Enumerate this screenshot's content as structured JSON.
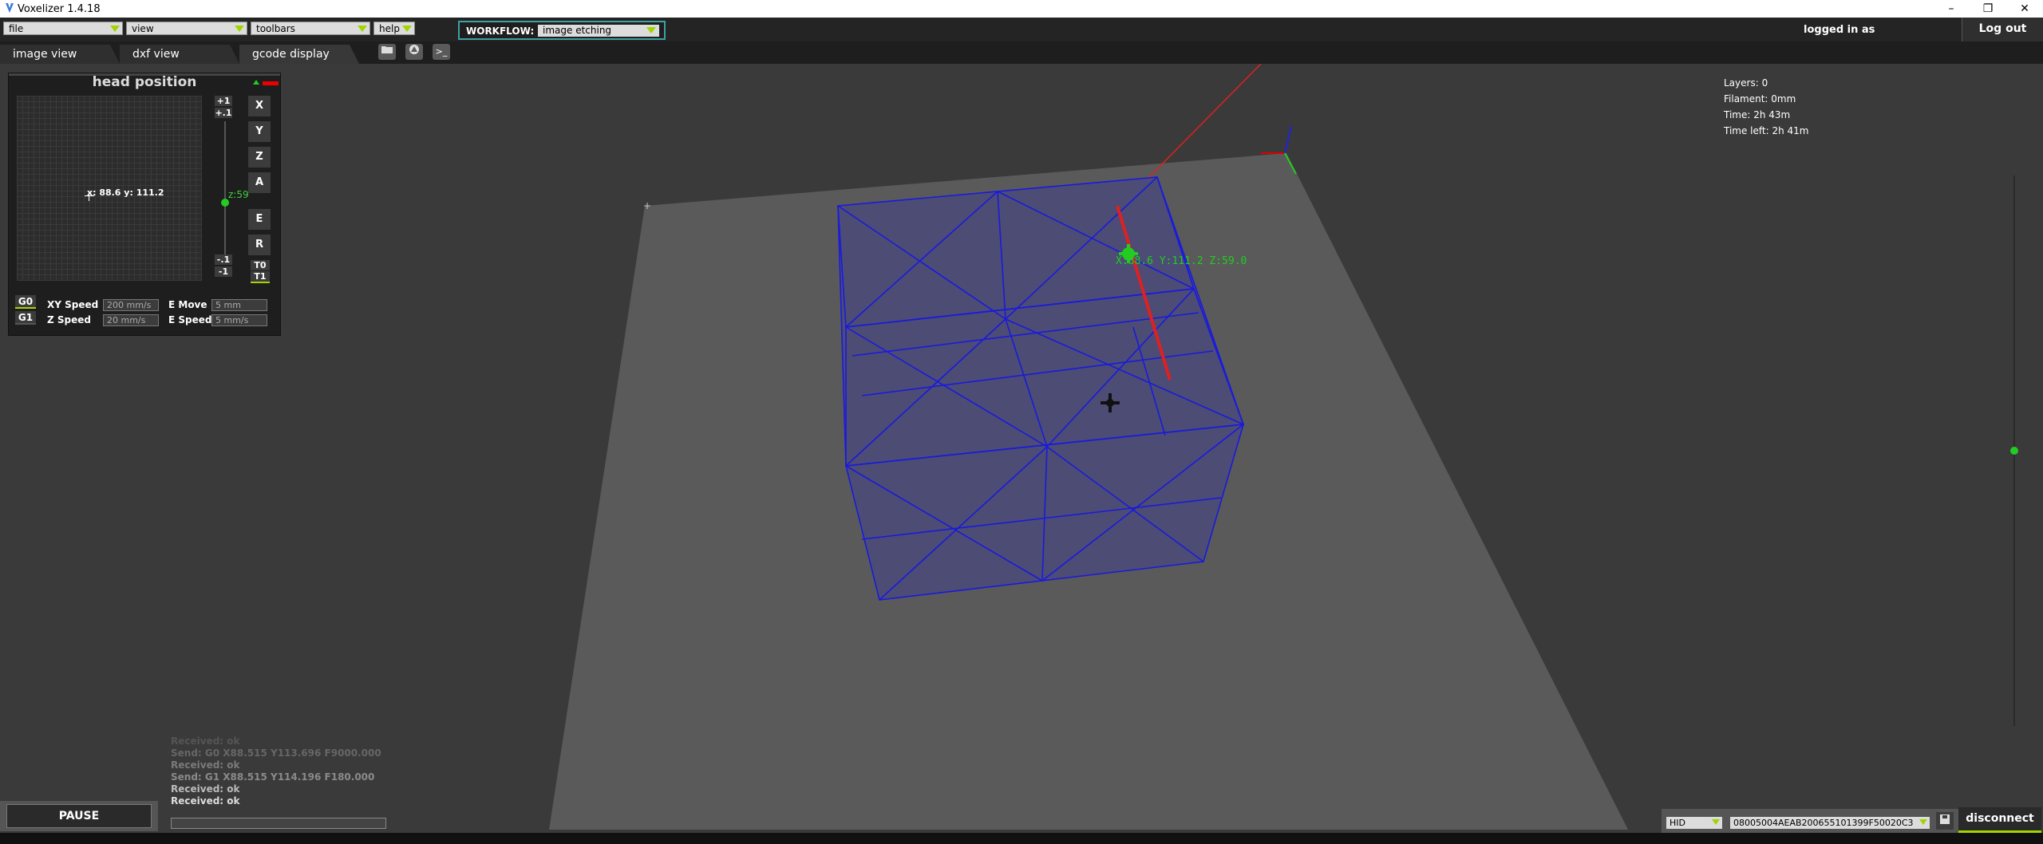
{
  "window": {
    "title": "Voxelizer 1.4.18",
    "controls": [
      "–",
      "❐",
      "✕"
    ]
  },
  "menubar": {
    "file": "file",
    "view": "view",
    "toolbars": "toolbars",
    "help": "help",
    "workflow_label": "WORKFLOW:",
    "workflow_value": "image etching",
    "logged_in": "logged in as",
    "logout": "Log out"
  },
  "tabs": {
    "image_view": "image view",
    "dxf_view": "dxf view",
    "gcode_display": "gcode display",
    "gcode_btn": "Gcode",
    "terminal_btn": ">_"
  },
  "head_panel": {
    "title": "head position",
    "readout": "x: 88.6 y: 111.2",
    "z_label": "z:59",
    "step_up_1": "+1",
    "step_up_01": "+.1",
    "step_down_01": "-.1",
    "step_down_1": "-1",
    "axes": [
      "X",
      "Y",
      "Z",
      "A",
      "E",
      "R"
    ],
    "t0": "T0",
    "t1": "T1",
    "g0": "G0",
    "g1": "G1",
    "xy_speed_label": "XY Speed",
    "xy_speed_value": "200 mm/s",
    "z_speed_label": "Z Speed",
    "z_speed_value": "20 mm/s",
    "e_move_label": "E Move",
    "e_move_value": "5 mm",
    "e_speed_label": "E Speed",
    "e_speed_value": "5 mm/s"
  },
  "stats": {
    "layers": "Layers: 0",
    "filament": "Filament: 0mm",
    "time": "Time: 2h 43m",
    "time_left": "Time left: 2h 41m"
  },
  "head_label": "X:88.6 Y:111.2 Z:59.0",
  "log": [
    "Received: ok",
    "Send: G0 X88.515 Y113.696 F9000.000",
    "Received: ok",
    "Send: G1 X88.515 Y114.196 F180.000",
    "Received: ok",
    "Received: ok"
  ],
  "pause": "PAUSE",
  "connection": {
    "protocol": "HID",
    "port": "08005004AEAB200655101399F50020C3",
    "disconnect": "disconnect"
  },
  "colors": {
    "accent": "#a2d400",
    "wireframe": "#1a1add",
    "bed": "#5a5a5a",
    "head": "#22cc22"
  }
}
